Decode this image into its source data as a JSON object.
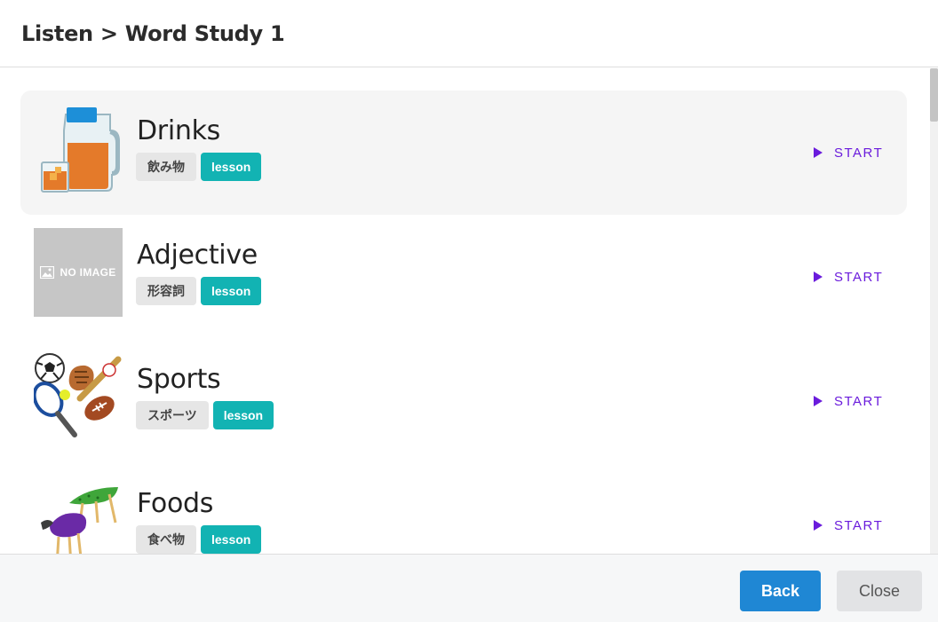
{
  "header": {
    "title": "Listen > Word Study 1"
  },
  "lessons": [
    {
      "title": "Drinks",
      "jp": "飲み物",
      "tag": "lesson",
      "start": "START",
      "thumb": "drinks-image"
    },
    {
      "title": "Adjective",
      "jp": "形容詞",
      "tag": "lesson",
      "start": "START",
      "thumb": "no-image-placeholder",
      "no_image": "NO IMAGE"
    },
    {
      "title": "Sports",
      "jp": "スポーツ",
      "tag": "lesson",
      "start": "START",
      "thumb": "sports-image"
    },
    {
      "title": "Foods",
      "jp": "食べ物",
      "tag": "lesson",
      "start": "START",
      "thumb": "foods-image"
    }
  ],
  "footer": {
    "back_label": "Back",
    "close_label": "Close"
  },
  "colors": {
    "accent": "#6a1bdc",
    "lesson_tag": "#12b3b3",
    "back_button": "#1f87d4",
    "active_row": "#f5f5f5"
  }
}
